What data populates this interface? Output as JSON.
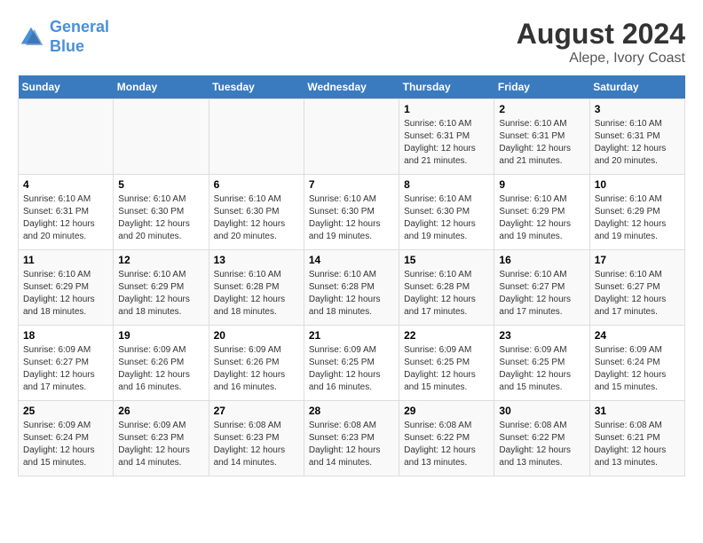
{
  "header": {
    "logo_line1": "General",
    "logo_line2": "Blue",
    "title": "August 2024",
    "subtitle": "Alepe, Ivory Coast"
  },
  "days_of_week": [
    "Sunday",
    "Monday",
    "Tuesday",
    "Wednesday",
    "Thursday",
    "Friday",
    "Saturday"
  ],
  "weeks": [
    [
      {
        "day": "",
        "info": ""
      },
      {
        "day": "",
        "info": ""
      },
      {
        "day": "",
        "info": ""
      },
      {
        "day": "",
        "info": ""
      },
      {
        "day": "1",
        "info": "Sunrise: 6:10 AM\nSunset: 6:31 PM\nDaylight: 12 hours\nand 21 minutes."
      },
      {
        "day": "2",
        "info": "Sunrise: 6:10 AM\nSunset: 6:31 PM\nDaylight: 12 hours\nand 21 minutes."
      },
      {
        "day": "3",
        "info": "Sunrise: 6:10 AM\nSunset: 6:31 PM\nDaylight: 12 hours\nand 20 minutes."
      }
    ],
    [
      {
        "day": "4",
        "info": "Sunrise: 6:10 AM\nSunset: 6:31 PM\nDaylight: 12 hours\nand 20 minutes."
      },
      {
        "day": "5",
        "info": "Sunrise: 6:10 AM\nSunset: 6:30 PM\nDaylight: 12 hours\nand 20 minutes."
      },
      {
        "day": "6",
        "info": "Sunrise: 6:10 AM\nSunset: 6:30 PM\nDaylight: 12 hours\nand 20 minutes."
      },
      {
        "day": "7",
        "info": "Sunrise: 6:10 AM\nSunset: 6:30 PM\nDaylight: 12 hours\nand 19 minutes."
      },
      {
        "day": "8",
        "info": "Sunrise: 6:10 AM\nSunset: 6:30 PM\nDaylight: 12 hours\nand 19 minutes."
      },
      {
        "day": "9",
        "info": "Sunrise: 6:10 AM\nSunset: 6:29 PM\nDaylight: 12 hours\nand 19 minutes."
      },
      {
        "day": "10",
        "info": "Sunrise: 6:10 AM\nSunset: 6:29 PM\nDaylight: 12 hours\nand 19 minutes."
      }
    ],
    [
      {
        "day": "11",
        "info": "Sunrise: 6:10 AM\nSunset: 6:29 PM\nDaylight: 12 hours\nand 18 minutes."
      },
      {
        "day": "12",
        "info": "Sunrise: 6:10 AM\nSunset: 6:29 PM\nDaylight: 12 hours\nand 18 minutes."
      },
      {
        "day": "13",
        "info": "Sunrise: 6:10 AM\nSunset: 6:28 PM\nDaylight: 12 hours\nand 18 minutes."
      },
      {
        "day": "14",
        "info": "Sunrise: 6:10 AM\nSunset: 6:28 PM\nDaylight: 12 hours\nand 18 minutes."
      },
      {
        "day": "15",
        "info": "Sunrise: 6:10 AM\nSunset: 6:28 PM\nDaylight: 12 hours\nand 17 minutes."
      },
      {
        "day": "16",
        "info": "Sunrise: 6:10 AM\nSunset: 6:27 PM\nDaylight: 12 hours\nand 17 minutes."
      },
      {
        "day": "17",
        "info": "Sunrise: 6:10 AM\nSunset: 6:27 PM\nDaylight: 12 hours\nand 17 minutes."
      }
    ],
    [
      {
        "day": "18",
        "info": "Sunrise: 6:09 AM\nSunset: 6:27 PM\nDaylight: 12 hours\nand 17 minutes."
      },
      {
        "day": "19",
        "info": "Sunrise: 6:09 AM\nSunset: 6:26 PM\nDaylight: 12 hours\nand 16 minutes."
      },
      {
        "day": "20",
        "info": "Sunrise: 6:09 AM\nSunset: 6:26 PM\nDaylight: 12 hours\nand 16 minutes."
      },
      {
        "day": "21",
        "info": "Sunrise: 6:09 AM\nSunset: 6:25 PM\nDaylight: 12 hours\nand 16 minutes."
      },
      {
        "day": "22",
        "info": "Sunrise: 6:09 AM\nSunset: 6:25 PM\nDaylight: 12 hours\nand 15 minutes."
      },
      {
        "day": "23",
        "info": "Sunrise: 6:09 AM\nSunset: 6:25 PM\nDaylight: 12 hours\nand 15 minutes."
      },
      {
        "day": "24",
        "info": "Sunrise: 6:09 AM\nSunset: 6:24 PM\nDaylight: 12 hours\nand 15 minutes."
      }
    ],
    [
      {
        "day": "25",
        "info": "Sunrise: 6:09 AM\nSunset: 6:24 PM\nDaylight: 12 hours\nand 15 minutes."
      },
      {
        "day": "26",
        "info": "Sunrise: 6:09 AM\nSunset: 6:23 PM\nDaylight: 12 hours\nand 14 minutes."
      },
      {
        "day": "27",
        "info": "Sunrise: 6:08 AM\nSunset: 6:23 PM\nDaylight: 12 hours\nand 14 minutes."
      },
      {
        "day": "28",
        "info": "Sunrise: 6:08 AM\nSunset: 6:23 PM\nDaylight: 12 hours\nand 14 minutes."
      },
      {
        "day": "29",
        "info": "Sunrise: 6:08 AM\nSunset: 6:22 PM\nDaylight: 12 hours\nand 13 minutes."
      },
      {
        "day": "30",
        "info": "Sunrise: 6:08 AM\nSunset: 6:22 PM\nDaylight: 12 hours\nand 13 minutes."
      },
      {
        "day": "31",
        "info": "Sunrise: 6:08 AM\nSunset: 6:21 PM\nDaylight: 12 hours\nand 13 minutes."
      }
    ]
  ]
}
